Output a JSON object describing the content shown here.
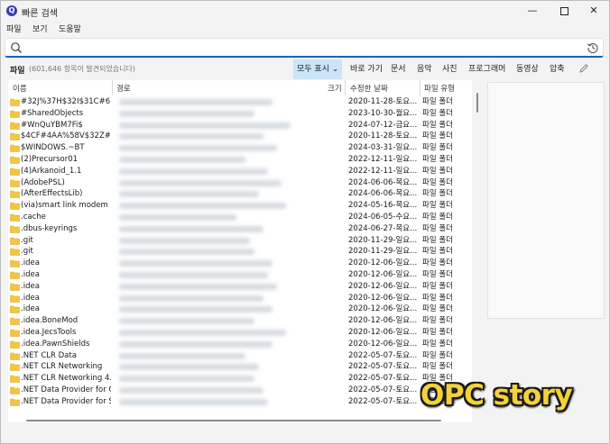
{
  "window": {
    "title": "빠른 검색",
    "minimize": "—",
    "close": "✕"
  },
  "menu": [
    "파일",
    "보기",
    "도움말"
  ],
  "search": {
    "value": "",
    "placeholder": ""
  },
  "filter": {
    "label": "파일",
    "count": "(601,646 항목이 발견되었습니다)",
    "buttons": [
      "모두 표시 ⌄",
      "바로 가기",
      "문서",
      "음악",
      "사진",
      "프로그래머",
      "동영상",
      "압축"
    ],
    "active": "모두 표시"
  },
  "columns": {
    "name": "이름",
    "path": "경로",
    "size": "크기",
    "date": "수정한 날짜",
    "type": "파일 유형"
  },
  "rows": [
    {
      "name": "#32J%37H$32I$31C#6...",
      "date": "2020-11-28-토요...",
      "type": "파일 폴더"
    },
    {
      "name": "#SharedObjects",
      "date": "2023-10-30-월요...",
      "type": "파일 폴더"
    },
    {
      "name": "#WnQuYBM7Fi$",
      "date": "2024-07-12-금요...",
      "type": "파일 폴더"
    },
    {
      "name": "$4CF#4AA%58V$32Z#3...",
      "date": "2020-11-28-토요...",
      "type": "파일 폴더"
    },
    {
      "name": "$WINDOWS.~BT",
      "date": "2024-03-31-일요...",
      "type": "파일 폴더"
    },
    {
      "name": "(2)Precursor01",
      "date": "2022-12-11-일요...",
      "type": "파일 폴더"
    },
    {
      "name": "(4)Arkanoid_1.1",
      "date": "2022-12-11-일요...",
      "type": "파일 폴더"
    },
    {
      "name": "(AdobePSL)",
      "date": "2024-06-06-목요...",
      "type": "파일 폴더"
    },
    {
      "name": "(AfterEffectsLib)",
      "date": "2024-06-06-목요...",
      "type": "파일 폴더"
    },
    {
      "name": "(via)smart link modem",
      "date": "2024-05-16-목요...",
      "type": "파일 폴더"
    },
    {
      "name": ".cache",
      "date": "2024-06-05-수요...",
      "type": "파일 폴더"
    },
    {
      "name": ".dbus-keyrings",
      "date": "2024-06-27-목요...",
      "type": "파일 폴더"
    },
    {
      "name": ".git",
      "date": "2020-11-29-일요...",
      "type": "파일 폴더"
    },
    {
      "name": ".git",
      "date": "2020-11-29-일요...",
      "type": "파일 폴더"
    },
    {
      "name": ".idea",
      "date": "2020-12-06-일요...",
      "type": "파일 폴더"
    },
    {
      "name": ".idea",
      "date": "2020-12-06-일요...",
      "type": "파일 폴더"
    },
    {
      "name": ".idea",
      "date": "2020-12-06-일요...",
      "type": "파일 폴더"
    },
    {
      "name": ".idea",
      "date": "2020-12-06-일요...",
      "type": "파일 폴더"
    },
    {
      "name": ".idea",
      "date": "2020-12-06-일요...",
      "type": "파일 폴더"
    },
    {
      "name": ".idea.BoneMod",
      "date": "2020-12-06-일요...",
      "type": "파일 폴더"
    },
    {
      "name": ".idea.JecsTools",
      "date": "2020-12-06-일요...",
      "type": "파일 폴더"
    },
    {
      "name": ".idea.PawnShields",
      "date": "2020-12-06-일요...",
      "type": "파일 폴더"
    },
    {
      "name": ".NET CLR Data",
      "date": "2022-05-07-토요...",
      "type": "파일 폴더"
    },
    {
      "name": ".NET CLR Networking",
      "date": "2022-05-07-토요...",
      "type": "파일 폴더"
    },
    {
      "name": ".NET CLR Networking 4....",
      "date": "2022-05-07-토요...",
      "type": "파일 폴더"
    },
    {
      "name": ".NET Data Provider for O...",
      "date": "2022-05-07-토요...",
      "type": "파일 폴더"
    },
    {
      "name": ".NET Data Provider for S...",
      "date": "2022-05-07-토요...",
      "type": "파일 폴더"
    }
  ],
  "watermark": "OPC story",
  "colors": {
    "accent": "#0067c0",
    "folder": "#f4c542",
    "active_filter": "#cce4f7",
    "watermark": "#f3d23a"
  }
}
